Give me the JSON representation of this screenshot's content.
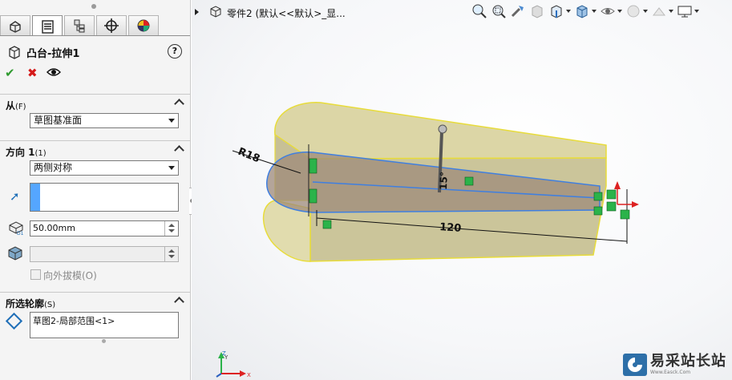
{
  "property_manager": {
    "tabs": [
      {
        "name": "feature-manager",
        "icon": "feature-tree-icon"
      },
      {
        "name": "property-manager",
        "icon": "property-manager-icon",
        "active": true
      },
      {
        "name": "configuration-manager",
        "icon": "configuration-icon"
      },
      {
        "name": "dimxpert-manager",
        "icon": "target-icon"
      },
      {
        "name": "display-manager",
        "icon": "appearance-icon"
      }
    ],
    "title": "凸台-拉伸1",
    "help_label": "?",
    "from_section": {
      "label": "从",
      "tag": "(F)",
      "select_value": "草图基准面"
    },
    "direction_section": {
      "label": "方向 1",
      "tag": "(1)",
      "end_condition": "两侧对称",
      "depth_value": "50.00mm",
      "draft_outward_label": "向外拔模(O)"
    },
    "contours_section": {
      "label": "所选轮廓",
      "tag": "(S)",
      "item": "草图2-局部范围<1>"
    }
  },
  "graphics": {
    "document_title": "零件2  (默认<<默认>_显...",
    "dimensions": {
      "radius": "R18",
      "length": "120",
      "height": "15°"
    },
    "triad_labels": {
      "x": "X",
      "y": "Y",
      "z": "Z"
    },
    "colors": {
      "body_face": "#d8d2a0",
      "body_edge": "#f0e33a",
      "sketch": "#3f7fe0",
      "relation": "#2bb34a"
    }
  },
  "watermark": {
    "text": "易采站长站",
    "sub": "Www.Easck.Com"
  }
}
